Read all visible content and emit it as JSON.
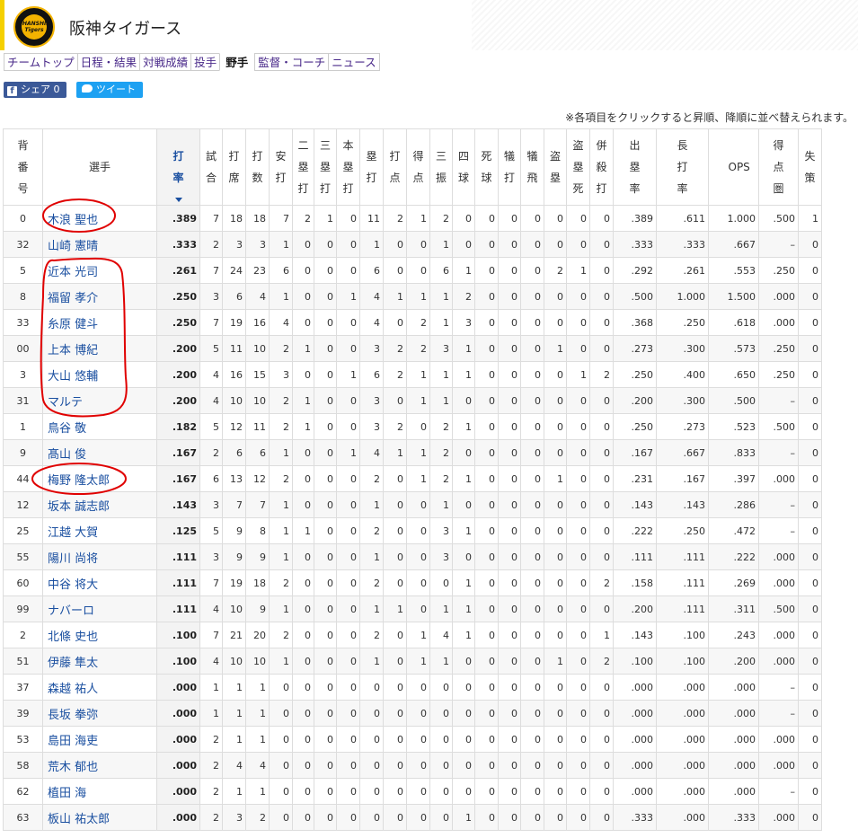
{
  "team": {
    "name": "阪神タイガース",
    "logo_text": "HANSHIN Tigers"
  },
  "nav": [
    {
      "label": "チームトップ",
      "active": false
    },
    {
      "label": "日程・結果",
      "active": false
    },
    {
      "label": "対戦成績",
      "active": false
    },
    {
      "label": "投手",
      "active": false
    },
    {
      "label": "野手",
      "active": true
    },
    {
      "label": "監督・コーチ",
      "active": false
    },
    {
      "label": "ニュース",
      "active": false
    }
  ],
  "share": {
    "facebook_label": "シェア 0",
    "twitter_label": "ツイート"
  },
  "note": "※各項目をクリックすると昇順、降順に並べ替えられます。",
  "columns": [
    "背番号",
    "選手",
    "打率",
    "試合",
    "打席",
    "打数",
    "安打",
    "二塁打",
    "三塁打",
    "本塁打",
    "塁打",
    "打点",
    "得点",
    "三振",
    "四球",
    "死球",
    "犠打",
    "犠飛",
    "盗塁",
    "盗塁死",
    "併殺打",
    "出塁率",
    "長打率",
    "OPS",
    "得点圏",
    "失策"
  ],
  "sorted_column": "打率",
  "players": [
    [
      "0",
      "木浪 聖也",
      ".389",
      "7",
      "18",
      "18",
      "7",
      "2",
      "1",
      "0",
      "11",
      "2",
      "1",
      "2",
      "0",
      "0",
      "0",
      "0",
      "0",
      "0",
      "0",
      ".389",
      ".611",
      "1.000",
      ".500",
      "1"
    ],
    [
      "32",
      "山崎 憲晴",
      ".333",
      "2",
      "3",
      "3",
      "1",
      "0",
      "0",
      "0",
      "1",
      "0",
      "0",
      "1",
      "0",
      "0",
      "0",
      "0",
      "0",
      "0",
      "0",
      ".333",
      ".333",
      ".667",
      "–",
      "0"
    ],
    [
      "5",
      "近本 光司",
      ".261",
      "7",
      "24",
      "23",
      "6",
      "0",
      "0",
      "0",
      "6",
      "0",
      "0",
      "6",
      "1",
      "0",
      "0",
      "0",
      "2",
      "1",
      "0",
      ".292",
      ".261",
      ".553",
      ".250",
      "0"
    ],
    [
      "8",
      "福留 孝介",
      ".250",
      "3",
      "6",
      "4",
      "1",
      "0",
      "0",
      "1",
      "4",
      "1",
      "1",
      "1",
      "2",
      "0",
      "0",
      "0",
      "0",
      "0",
      "0",
      ".500",
      "1.000",
      "1.500",
      ".000",
      "0"
    ],
    [
      "33",
      "糸原 健斗",
      ".250",
      "7",
      "19",
      "16",
      "4",
      "0",
      "0",
      "0",
      "4",
      "0",
      "2",
      "1",
      "3",
      "0",
      "0",
      "0",
      "0",
      "0",
      "0",
      ".368",
      ".250",
      ".618",
      ".000",
      "0"
    ],
    [
      "00",
      "上本 博紀",
      ".200",
      "5",
      "11",
      "10",
      "2",
      "1",
      "0",
      "0",
      "3",
      "2",
      "2",
      "3",
      "1",
      "0",
      "0",
      "0",
      "1",
      "0",
      "0",
      ".273",
      ".300",
      ".573",
      ".250",
      "0"
    ],
    [
      "3",
      "大山 悠輔",
      ".200",
      "4",
      "16",
      "15",
      "3",
      "0",
      "0",
      "1",
      "6",
      "2",
      "1",
      "1",
      "1",
      "0",
      "0",
      "0",
      "0",
      "1",
      "2",
      ".250",
      ".400",
      ".650",
      ".250",
      "0"
    ],
    [
      "31",
      "マルテ",
      ".200",
      "4",
      "10",
      "10",
      "2",
      "1",
      "0",
      "0",
      "3",
      "0",
      "1",
      "1",
      "0",
      "0",
      "0",
      "0",
      "0",
      "0",
      "0",
      ".200",
      ".300",
      ".500",
      "–",
      "0"
    ],
    [
      "1",
      "鳥谷 敬",
      ".182",
      "5",
      "12",
      "11",
      "2",
      "1",
      "0",
      "0",
      "3",
      "2",
      "0",
      "2",
      "1",
      "0",
      "0",
      "0",
      "0",
      "0",
      "0",
      ".250",
      ".273",
      ".523",
      ".500",
      "0"
    ],
    [
      "9",
      "髙山 俊",
      ".167",
      "2",
      "6",
      "6",
      "1",
      "0",
      "0",
      "1",
      "4",
      "1",
      "1",
      "2",
      "0",
      "0",
      "0",
      "0",
      "0",
      "0",
      "0",
      ".167",
      ".667",
      ".833",
      "–",
      "0"
    ],
    [
      "44",
      "梅野 隆太郎",
      ".167",
      "6",
      "13",
      "12",
      "2",
      "0",
      "0",
      "0",
      "2",
      "0",
      "1",
      "2",
      "1",
      "0",
      "0",
      "0",
      "1",
      "0",
      "0",
      ".231",
      ".167",
      ".397",
      ".000",
      "0"
    ],
    [
      "12",
      "坂本 誠志郎",
      ".143",
      "3",
      "7",
      "7",
      "1",
      "0",
      "0",
      "0",
      "1",
      "0",
      "0",
      "1",
      "0",
      "0",
      "0",
      "0",
      "0",
      "0",
      "0",
      ".143",
      ".143",
      ".286",
      "–",
      "0"
    ],
    [
      "25",
      "江越 大賀",
      ".125",
      "5",
      "9",
      "8",
      "1",
      "1",
      "0",
      "0",
      "2",
      "0",
      "0",
      "3",
      "1",
      "0",
      "0",
      "0",
      "0",
      "0",
      "0",
      ".222",
      ".250",
      ".472",
      "–",
      "0"
    ],
    [
      "55",
      "陽川 尚将",
      ".111",
      "3",
      "9",
      "9",
      "1",
      "0",
      "0",
      "0",
      "1",
      "0",
      "0",
      "3",
      "0",
      "0",
      "0",
      "0",
      "0",
      "0",
      "0",
      ".111",
      ".111",
      ".222",
      ".000",
      "0"
    ],
    [
      "60",
      "中谷 将大",
      ".111",
      "7",
      "19",
      "18",
      "2",
      "0",
      "0",
      "0",
      "2",
      "0",
      "0",
      "0",
      "1",
      "0",
      "0",
      "0",
      "0",
      "0",
      "2",
      ".158",
      ".111",
      ".269",
      ".000",
      "0"
    ],
    [
      "99",
      "ナバーロ",
      ".111",
      "4",
      "10",
      "9",
      "1",
      "0",
      "0",
      "0",
      "1",
      "1",
      "0",
      "1",
      "1",
      "0",
      "0",
      "0",
      "0",
      "0",
      "0",
      ".200",
      ".111",
      ".311",
      ".500",
      "0"
    ],
    [
      "2",
      "北條 史也",
      ".100",
      "7",
      "21",
      "20",
      "2",
      "0",
      "0",
      "0",
      "2",
      "0",
      "1",
      "4",
      "1",
      "0",
      "0",
      "0",
      "0",
      "0",
      "1",
      ".143",
      ".100",
      ".243",
      ".000",
      "0"
    ],
    [
      "51",
      "伊藤 隼太",
      ".100",
      "4",
      "10",
      "10",
      "1",
      "0",
      "0",
      "0",
      "1",
      "0",
      "1",
      "1",
      "0",
      "0",
      "0",
      "0",
      "1",
      "0",
      "2",
      ".100",
      ".100",
      ".200",
      ".000",
      "0"
    ],
    [
      "37",
      "森越 祐人",
      ".000",
      "1",
      "1",
      "1",
      "0",
      "0",
      "0",
      "0",
      "0",
      "0",
      "0",
      "0",
      "0",
      "0",
      "0",
      "0",
      "0",
      "0",
      "0",
      ".000",
      ".000",
      ".000",
      "–",
      "0"
    ],
    [
      "39",
      "長坂 拳弥",
      ".000",
      "1",
      "1",
      "1",
      "0",
      "0",
      "0",
      "0",
      "0",
      "0",
      "0",
      "0",
      "0",
      "0",
      "0",
      "0",
      "0",
      "0",
      "0",
      ".000",
      ".000",
      ".000",
      "–",
      "0"
    ],
    [
      "53",
      "島田 海吏",
      ".000",
      "2",
      "1",
      "1",
      "0",
      "0",
      "0",
      "0",
      "0",
      "0",
      "0",
      "0",
      "0",
      "0",
      "0",
      "0",
      "0",
      "0",
      "0",
      ".000",
      ".000",
      ".000",
      ".000",
      "0"
    ],
    [
      "58",
      "荒木 郁也",
      ".000",
      "2",
      "4",
      "4",
      "0",
      "0",
      "0",
      "0",
      "0",
      "0",
      "0",
      "0",
      "0",
      "0",
      "0",
      "0",
      "0",
      "0",
      "0",
      ".000",
      ".000",
      ".000",
      ".000",
      "0"
    ],
    [
      "62",
      "植田 海",
      ".000",
      "2",
      "1",
      "1",
      "0",
      "0",
      "0",
      "0",
      "0",
      "0",
      "0",
      "0",
      "0",
      "0",
      "0",
      "0",
      "0",
      "0",
      "0",
      ".000",
      ".000",
      ".000",
      "–",
      "0"
    ],
    [
      "63",
      "板山 祐太郎",
      ".000",
      "2",
      "3",
      "2",
      "0",
      "0",
      "0",
      "0",
      "0",
      "0",
      "0",
      "0",
      "1",
      "0",
      "0",
      "0",
      "0",
      "0",
      "0",
      ".333",
      ".000",
      ".333",
      ".000",
      "0"
    ]
  ],
  "annotation_color": "#e00000"
}
